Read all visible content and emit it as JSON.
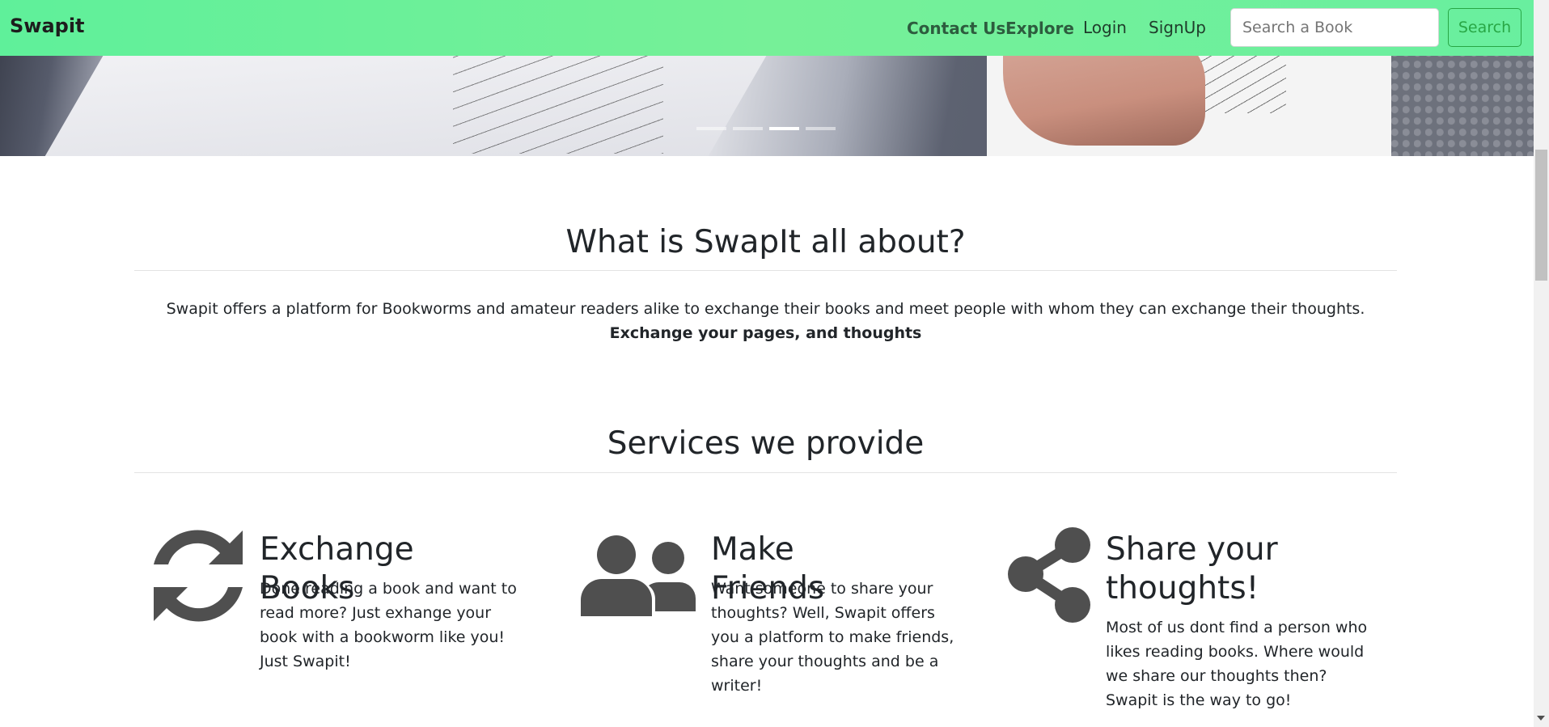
{
  "navbar": {
    "brand": "Swapit",
    "links": [
      {
        "label": "Contact Us"
      },
      {
        "label": "Explore"
      },
      {
        "label": "Login"
      },
      {
        "label": "SignUp"
      }
    ],
    "search": {
      "placeholder": "Search a Book",
      "value": "",
      "button_label": "Search"
    }
  },
  "carousel": {
    "slide_count": 4,
    "active_index": 2
  },
  "about": {
    "title": "What is SwapIt all about?",
    "text": "Swapit offers a platform for Bookworms and amateur readers alike to exchange their books and meet people with whom they can exchange their thoughts.",
    "text_bold": "Exchange your pages, and thoughts"
  },
  "services": {
    "title": "Services we provide",
    "items": [
      {
        "icon": "sync-icon",
        "title": "Exchange Books",
        "description": "Done reading a book and want to read more? Just exhange your book with a bookworm like you! Just Swapit!"
      },
      {
        "icon": "users-icon",
        "title": "Make Friends",
        "description": "Want someone to share your thoughts? Well, Swapit offers you a platform to make friends, share your thoughts and be a writer!"
      },
      {
        "icon": "share-icon",
        "title": "Share your thoughts!",
        "description": "Most of us dont find a person who likes reading books. Where would we share our thoughts then? Swapit is the way to go!"
      }
    ]
  },
  "colors": {
    "navbar_start": "#5ff09a",
    "navbar_end": "#69ef9f",
    "search_button": "#28a745",
    "icon": "#4f4f4f"
  }
}
